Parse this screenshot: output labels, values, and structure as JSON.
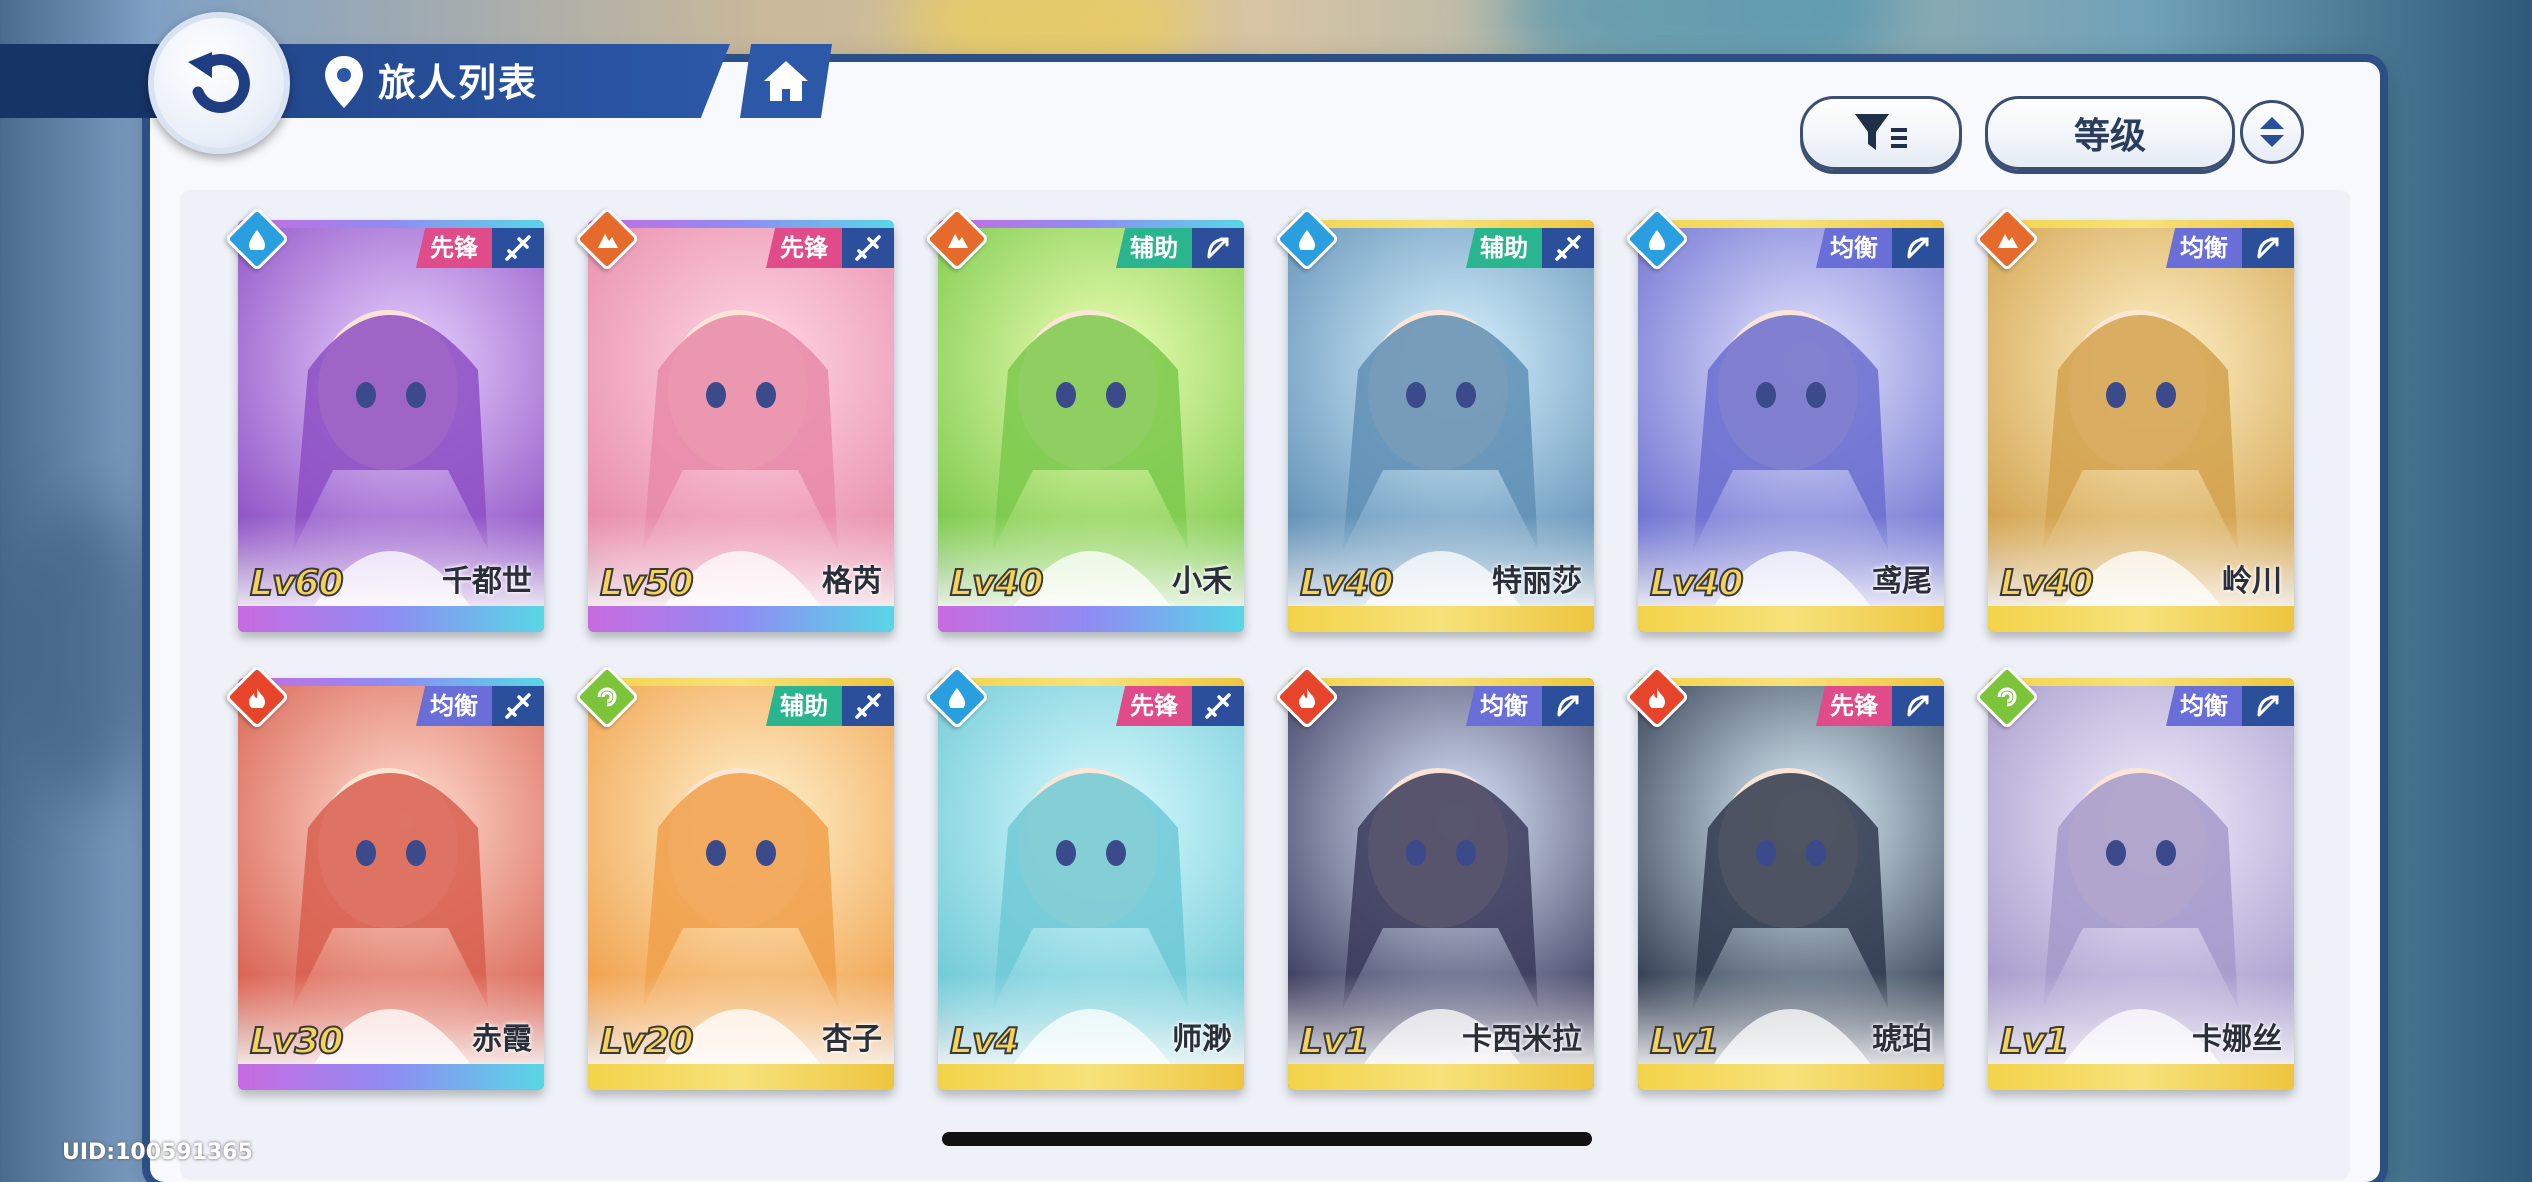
{
  "header": {
    "title": "旅人列表"
  },
  "toolbar": {
    "sort_label": "等级"
  },
  "colors": {
    "vanguard": "#e04c8a",
    "support": "#2bb58e",
    "balanced": "#6a6fd8",
    "water": "#2a9fe0",
    "earth": "#e56a2c",
    "fire": "#e6452c",
    "wind": "#7cc43a"
  },
  "roster": [
    {
      "name": "千都世",
      "level": "Lv60",
      "role": "先锋",
      "element": "water-icon",
      "weapon": "sword-icon",
      "rarity": "purple"
    },
    {
      "name": "格芮",
      "level": "Lv50",
      "role": "先锋",
      "element": "earth-icon",
      "weapon": "sword-icon",
      "rarity": "purple"
    },
    {
      "name": "小禾",
      "level": "Lv40",
      "role": "辅助",
      "element": "earth-icon",
      "weapon": "bow-icon",
      "rarity": "purple"
    },
    {
      "name": "特丽莎",
      "level": "Lv40",
      "role": "辅助",
      "element": "water-icon",
      "weapon": "sword-icon",
      "rarity": "gold"
    },
    {
      "name": "鸢尾",
      "level": "Lv40",
      "role": "均衡",
      "element": "water-icon",
      "weapon": "bow-icon",
      "rarity": "gold"
    },
    {
      "name": "岭川",
      "level": "Lv40",
      "role": "均衡",
      "element": "earth-icon",
      "weapon": "bow-icon",
      "rarity": "gold"
    },
    {
      "name": "赤霞",
      "level": "Lv30",
      "role": "均衡",
      "element": "fire-icon",
      "weapon": "sword-icon",
      "rarity": "purple"
    },
    {
      "name": "杏子",
      "level": "Lv20",
      "role": "辅助",
      "element": "wind-icon",
      "weapon": "sword-icon",
      "rarity": "gold"
    },
    {
      "name": "师渺",
      "level": "Lv4",
      "role": "先锋",
      "element": "water-icon",
      "weapon": "sword-icon",
      "rarity": "gold"
    },
    {
      "name": "卡西米拉",
      "level": "Lv1",
      "role": "均衡",
      "element": "fire-icon",
      "weapon": "bow-icon",
      "rarity": "gold"
    },
    {
      "name": "琥珀",
      "level": "Lv1",
      "role": "先锋",
      "element": "fire-icon",
      "weapon": "bow-icon",
      "rarity": "gold"
    },
    {
      "name": "卡娜丝",
      "level": "Lv1",
      "role": "均衡",
      "element": "wind-icon",
      "weapon": "bow-icon",
      "rarity": "gold"
    }
  ],
  "footer": {
    "uid": "UID:100591365"
  }
}
